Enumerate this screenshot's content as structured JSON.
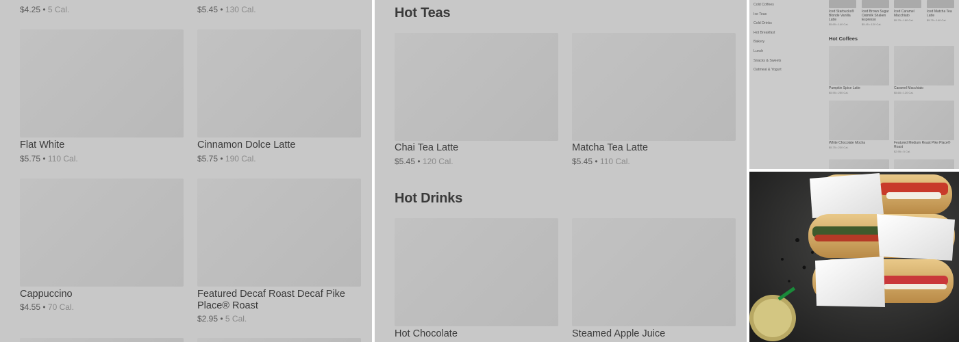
{
  "left_panel": {
    "top_prices": [
      {
        "price": "$4.25",
        "cal": "5 Cal."
      },
      {
        "price": "$5.45",
        "cal": "130 Cal."
      }
    ],
    "items": [
      {
        "name": "Flat White",
        "price": "$5.75",
        "cal": "110 Cal."
      },
      {
        "name": "Cinnamon Dolce Latte",
        "price": "$5.75",
        "cal": "190 Cal."
      },
      {
        "name": "Cappuccino",
        "price": "$4.55",
        "cal": "70 Cal."
      },
      {
        "name": "Featured Decaf Roast Decaf Pike Place® Roast",
        "price": "$2.95",
        "cal": "5 Cal."
      }
    ]
  },
  "middle_panel": {
    "section_1": "Hot Teas",
    "teas": [
      {
        "name": "Chai Tea Latte",
        "price": "$5.45",
        "cal": "120 Cal."
      },
      {
        "name": "Matcha Tea Latte",
        "price": "$5.45",
        "cal": "110 Cal."
      }
    ],
    "section_2": "Hot Drinks",
    "drinks": [
      {
        "name": "Hot Chocolate"
      },
      {
        "name": "Steamed Apple Juice"
      }
    ]
  },
  "desktop_panel": {
    "nav": [
      "Cold Coffees",
      "Ice Teas",
      "Cold Drinks",
      "Hot Breakfast",
      "Bakery",
      "Lunch",
      "Snacks & Sweets",
      "Oatmeal & Yogurt"
    ],
    "top_items": [
      {
        "name": "Iced Starbucks® Blonde Vanilla Latte",
        "price": "$5.65",
        "cal": "140 Cal."
      },
      {
        "name": "Iced Brown Sugar Oatmilk Shaken Espresso",
        "price": "$5.45",
        "cal": "120 Cal."
      },
      {
        "name": "Iced Caramel Macchiato",
        "price": "$5.75",
        "cal": "180 Cal."
      },
      {
        "name": "Iced Matcha Tea Latte",
        "price": "$5.75",
        "cal": "140 Cal."
      }
    ],
    "section": "Hot Coffees",
    "items": [
      {
        "name": "Pumpkin Spice Latte",
        "price": "$5.95",
        "cal": "250 Cal."
      },
      {
        "name": "Caramel Macchiato",
        "price": "$5.65",
        "cal": "120 Cal."
      },
      {
        "name": "White Chocolate Mocha",
        "price": "$5.75",
        "cal": "230 Cal."
      },
      {
        "name": "Featured Medium Roast Pike Place® Roast",
        "price": "$2.95",
        "cal": "5 Cal."
      }
    ]
  },
  "photo": {
    "subject": "sandwiches-and-iced-drink"
  }
}
